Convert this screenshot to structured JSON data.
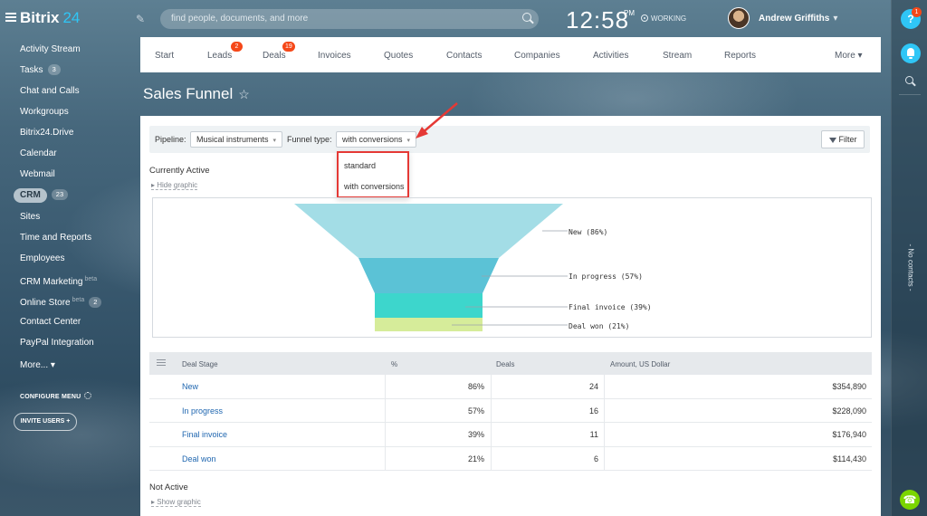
{
  "app": {
    "logo_main": "Bitrix",
    "logo_num": "24"
  },
  "search": {
    "placeholder": "find people, documents, and more"
  },
  "clock": {
    "time": "12:58",
    "ampm": "PM",
    "status": "WORKING"
  },
  "user": {
    "name": "Andrew Griffiths"
  },
  "sidebar": {
    "items": [
      {
        "label": "Activity Stream"
      },
      {
        "label": "Tasks",
        "count": "3"
      },
      {
        "label": "Chat and Calls"
      },
      {
        "label": "Workgroups"
      },
      {
        "label": "Bitrix24.Drive"
      },
      {
        "label": "Calendar"
      },
      {
        "label": "Webmail"
      },
      {
        "label": "CRM",
        "count": "23"
      },
      {
        "label": "Sites"
      },
      {
        "label": "Time and Reports"
      },
      {
        "label": "Employees"
      },
      {
        "label": "CRM Marketing",
        "beta": "beta"
      },
      {
        "label": "Online Store",
        "beta": "beta",
        "count": "2"
      },
      {
        "label": "Contact Center"
      },
      {
        "label": "PayPal Integration"
      },
      {
        "label": "More... ▾"
      }
    ],
    "configure_label": "CONFIGURE MENU",
    "invite_label": "INVITE USERS  +"
  },
  "right_strip": {
    "help": "?",
    "help_badge": "1",
    "no_contacts": "- No contacts -"
  },
  "nav": {
    "tabs": [
      {
        "label": "Start"
      },
      {
        "label": "Leads",
        "badge": "2"
      },
      {
        "label": "Deals",
        "badge": "19"
      },
      {
        "label": "Invoices"
      },
      {
        "label": "Quotes"
      },
      {
        "label": "Contacts"
      },
      {
        "label": "Companies"
      },
      {
        "label": "Activities"
      },
      {
        "label": "Stream"
      },
      {
        "label": "Reports"
      },
      {
        "label": "More ▾"
      }
    ]
  },
  "page": {
    "title": "Sales Funnel"
  },
  "filterbar": {
    "pipeline_label": "Pipeline:",
    "pipeline_value": "Musical instruments",
    "funnel_type_label": "Funnel type:",
    "funnel_type_value": "with conversions",
    "filter_label": "Filter",
    "dropdown_options": [
      "standard",
      "with conversions"
    ]
  },
  "sections": {
    "active_title": "Currently Active",
    "hide_graphic": "Hide graphic",
    "inactive_title": "Not Active",
    "show_graphic": "Show graphic"
  },
  "funnel": {
    "stages": [
      {
        "label": "New (86%)",
        "color": "#a3dde6"
      },
      {
        "label": "In progress (57%)",
        "color": "#5bc2d6"
      },
      {
        "label": "Final invoice (39%)",
        "color": "#3dd6cc"
      },
      {
        "label": "Deal won (21%)",
        "color": "#d6ec9a"
      }
    ]
  },
  "table": {
    "headers": [
      "Deal Stage",
      "%",
      "Deals",
      "Amount, US Dollar"
    ],
    "rows": [
      {
        "stage": "New",
        "pct": "86%",
        "deals": "24",
        "amount": "$354,890"
      },
      {
        "stage": "In progress",
        "pct": "57%",
        "deals": "16",
        "amount": "$228,090"
      },
      {
        "stage": "Final invoice",
        "pct": "39%",
        "deals": "11",
        "amount": "$176,940"
      },
      {
        "stage": "Deal won",
        "pct": "21%",
        "deals": "6",
        "amount": "$114,430"
      }
    ]
  }
}
